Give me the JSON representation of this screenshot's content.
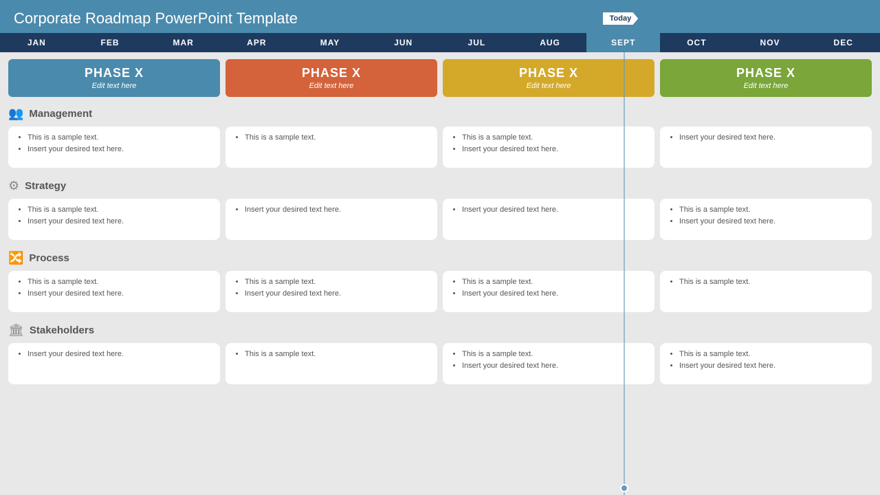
{
  "title": "Corporate Roadmap PowerPoint Template",
  "months": [
    {
      "label": "JAN",
      "highlight": false
    },
    {
      "label": "FEB",
      "highlight": false
    },
    {
      "label": "MAR",
      "highlight": false
    },
    {
      "label": "APR",
      "highlight": false
    },
    {
      "label": "MAY",
      "highlight": false
    },
    {
      "label": "JUN",
      "highlight": false
    },
    {
      "label": "JUL",
      "highlight": false
    },
    {
      "label": "AUG",
      "highlight": false
    },
    {
      "label": "SEPT",
      "highlight": true
    },
    {
      "label": "OCT",
      "highlight": false
    },
    {
      "label": "NOV",
      "highlight": false
    },
    {
      "label": "DEC",
      "highlight": false
    }
  ],
  "today_label": "Today",
  "phases": [
    {
      "title": "PHASE X",
      "subtitle": "Edit text here",
      "color": "blue"
    },
    {
      "title": "PHASE X",
      "subtitle": "Edit text here",
      "color": "orange"
    },
    {
      "title": "PHASE X",
      "subtitle": "Edit text here",
      "color": "yellow"
    },
    {
      "title": "PHASE X",
      "subtitle": "Edit text here",
      "color": "green"
    }
  ],
  "sections": [
    {
      "id": "management",
      "label": "Management",
      "icon": "👥",
      "cards": [
        {
          "items": [
            "This is a sample text.",
            "Insert your desired text here."
          ]
        },
        {
          "items": [
            "This is a sample text."
          ]
        },
        {
          "items": [
            "This is a sample text.",
            "Insert your desired text here."
          ]
        },
        {
          "items": [
            "Insert your desired text here."
          ]
        }
      ]
    },
    {
      "id": "strategy",
      "label": "Strategy",
      "icon": "🔧",
      "cards": [
        {
          "items": [
            "This is a sample text.",
            "Insert your desired text here."
          ]
        },
        {
          "items": [
            "Insert your desired text here."
          ]
        },
        {
          "items": [
            "Insert your desired text here."
          ]
        },
        {
          "items": [
            "This is a sample text.",
            "Insert your desired text here."
          ]
        }
      ]
    },
    {
      "id": "process",
      "label": "Process",
      "icon": "🔄",
      "cards": [
        {
          "items": [
            "This is a sample text.",
            "Insert your desired text here."
          ]
        },
        {
          "items": [
            "This is a sample text.",
            "Insert your desired text here."
          ]
        },
        {
          "items": [
            "This is a sample text.",
            "Insert your desired text here."
          ]
        },
        {
          "items": [
            "This is a sample text."
          ]
        }
      ]
    },
    {
      "id": "stakeholders",
      "label": "Stakeholders",
      "icon": "🏛",
      "cards": [
        {
          "items": [
            "Insert your desired text here."
          ]
        },
        {
          "items": [
            "This is a sample text."
          ]
        },
        {
          "items": [
            "This is a sample text.",
            "Insert your desired text here."
          ]
        },
        {
          "items": [
            "This is a sample text.",
            "Insert your desired text here."
          ]
        }
      ]
    }
  ]
}
